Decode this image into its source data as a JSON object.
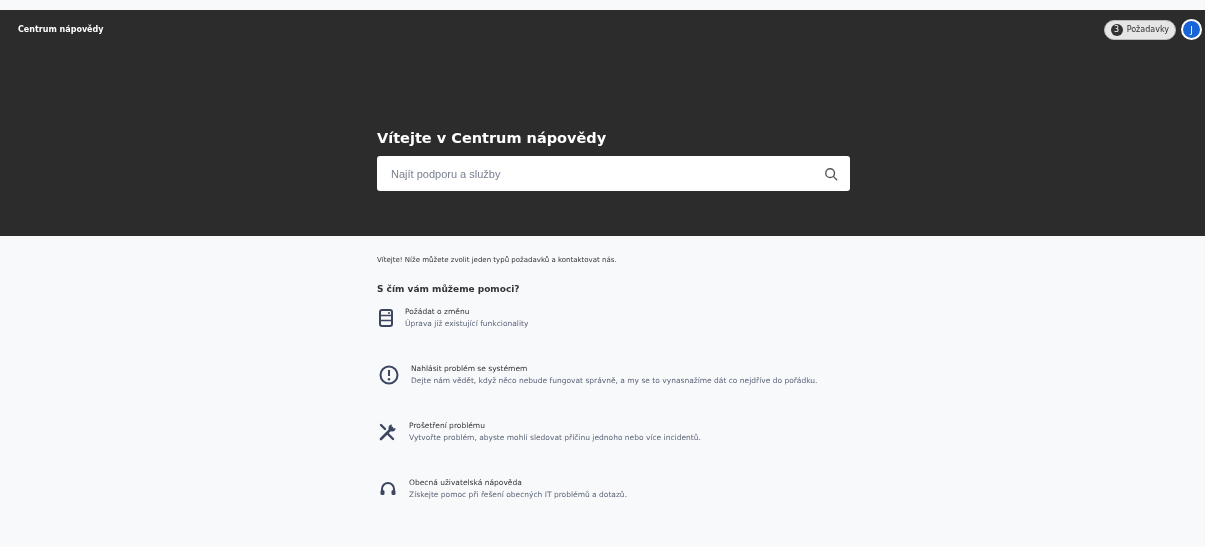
{
  "header": {
    "title": "Centrum nápovědy",
    "requests": {
      "count": "3",
      "label": "Požadavky"
    },
    "avatar": "J"
  },
  "hero": {
    "heading": "Vítejte v Centrum nápovědy",
    "search": {
      "placeholder": "Najít podporu a služby"
    }
  },
  "intro": "Vítejte! Níže můžete zvolit jeden typů požadavků a kontaktovat nás.",
  "section_title": "S čím vám můžeme pomoci?",
  "request_types": [
    {
      "kind": "form",
      "title": "Požádat o změnu",
      "description": "Úprava již existující funkcionality"
    },
    {
      "kind": "alert",
      "title": "Nahlásit problém se systémem",
      "description": "Dejte nám vědět, když něco nebude fungovat správně, a my se to vynasnažíme dát co nejdříve do pořádku."
    },
    {
      "kind": "tools",
      "title": "Prošetření problému",
      "description": "Vytvořte problém, abyste mohli sledovat příčinu jednoho nebo více incidentů."
    },
    {
      "kind": "headset",
      "title": "Obecná uživatelská nápověda",
      "description": "Získejte pomoc při řešení obecných IT problémů a dotazů."
    }
  ]
}
